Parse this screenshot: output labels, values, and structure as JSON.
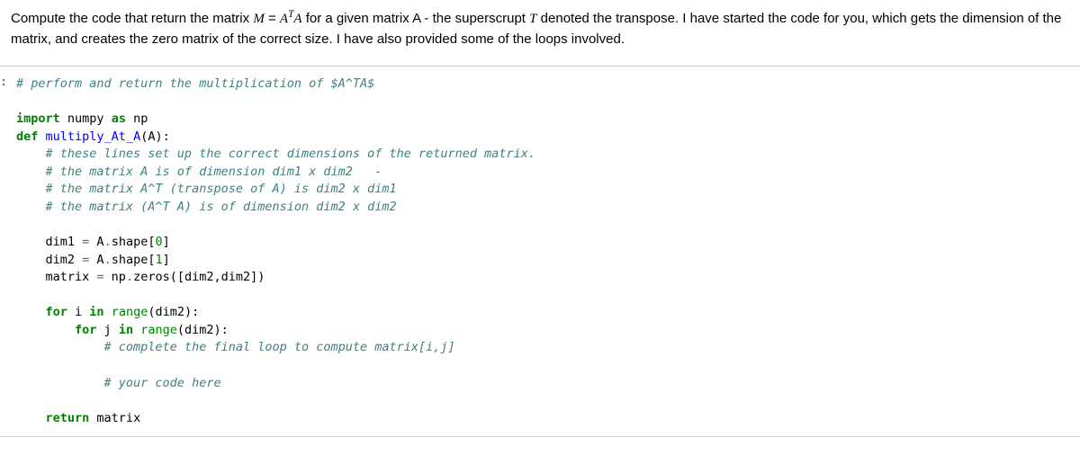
{
  "instruction": {
    "prefix": "Compute the code that return the matrix ",
    "eq_lhs": "M",
    "eq_rhs_base": "A",
    "eq_rhs_sup": "T",
    "eq_rhs_tail": "A",
    "mid1": " for a given matrix A - the superscrupt ",
    "transpose_sym": "T",
    "mid2": " denoted the transpose. I have started the code for you, which gets the dimension of the matrix, and creates the zero matrix of the correct size. I have also provided some of the loops involved."
  },
  "prompt_label": ":",
  "code": {
    "l01": "# perform and return the multiplication of $A^TA$",
    "l02": "",
    "l03_a": "import",
    "l03_b": " numpy ",
    "l03_c": "as",
    "l03_d": " np",
    "l04_a": "def",
    "l04_b": " ",
    "l04_c": "multiply_At_A",
    "l04_d": "(A):",
    "l05": "    # these lines set up the correct dimensions of the returned matrix.",
    "l06": "    # the matrix A is of dimension dim1 x dim2   -",
    "l07": "    # the matrix A^T (transpose of A) is dim2 x dim1",
    "l08": "    # the matrix (A^T A) is of dimension dim2 x dim2",
    "l09": "",
    "l10_a": "    dim1 ",
    "l10_b": "=",
    "l10_c": " A",
    "l10_d": ".",
    "l10_e": "shape[",
    "l10_f": "0",
    "l10_g": "]",
    "l11_a": "    dim2 ",
    "l11_b": "=",
    "l11_c": " A",
    "l11_d": ".",
    "l11_e": "shape[",
    "l11_f": "1",
    "l11_g": "]",
    "l12_a": "    matrix ",
    "l12_b": "=",
    "l12_c": " np",
    "l12_d": ".",
    "l12_e": "zeros([dim2,dim2])",
    "l13": "",
    "l14_a": "    ",
    "l14_b": "for",
    "l14_c": " i ",
    "l14_d": "in",
    "l14_e": " ",
    "l14_f": "range",
    "l14_g": "(dim2):",
    "l15_a": "        ",
    "l15_b": "for",
    "l15_c": " j ",
    "l15_d": "in",
    "l15_e": " ",
    "l15_f": "range",
    "l15_g": "(dim2):",
    "l16": "            # complete the final loop to compute matrix[i,j]",
    "l17": "",
    "l18": "            # your code here",
    "l19": "",
    "l20_a": "    ",
    "l20_b": "return",
    "l20_c": " matrix"
  }
}
